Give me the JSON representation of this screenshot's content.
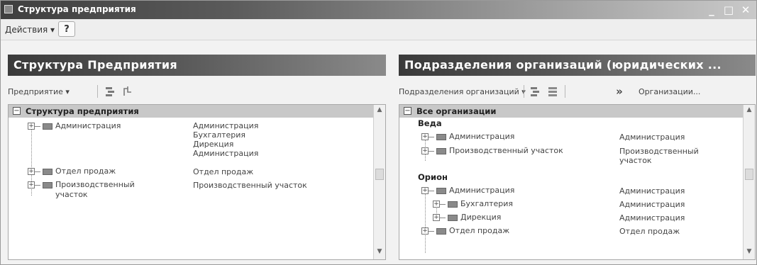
{
  "window": {
    "title": "Структура предприятия",
    "minimize": "_",
    "maximize": "□",
    "close": "✕"
  },
  "actions": {
    "menu_label": "Действия ▾",
    "help_label": "?"
  },
  "left_panel": {
    "header": "Структура Предприятия",
    "toolbar_menu": "Предприятие ▾",
    "tree_root": "Структура предприятия",
    "rows": [
      {
        "label": "Администрация",
        "value": "Администрация\nБухгалтерия\nДирекция\nАдминистрация"
      },
      {
        "label": "Отдел продаж",
        "value": "Отдел продаж"
      },
      {
        "label": "Производственный\nучасток",
        "value": "Производственный участок"
      }
    ]
  },
  "right_panel": {
    "header": "Подразделения организаций (юридических ...",
    "toolbar_menu": "Подразделения организаций ▾",
    "toolbar_more": "»",
    "toolbar_org": "Организации...",
    "tree_root": "Все организации",
    "groups": [
      {
        "name": "Веда",
        "rows": [
          {
            "label": "Администрация",
            "value": "Администрация"
          },
          {
            "label": "Производственный участок",
            "value": "Производственный\nучасток"
          }
        ]
      },
      {
        "name": "Орион",
        "rows": [
          {
            "label": "Администрация",
            "value": "Администрация"
          },
          {
            "label": "Бухгалтерия",
            "value": "Администрация"
          },
          {
            "label": "Дирекция",
            "value": "Администрация"
          },
          {
            "label": "Отдел продаж",
            "value": "Отдел продаж"
          }
        ]
      }
    ]
  },
  "icons": {
    "expander_collapsed": "+",
    "root_toggle": "−",
    "scroll_up": "▲",
    "scroll_down": "▼"
  }
}
